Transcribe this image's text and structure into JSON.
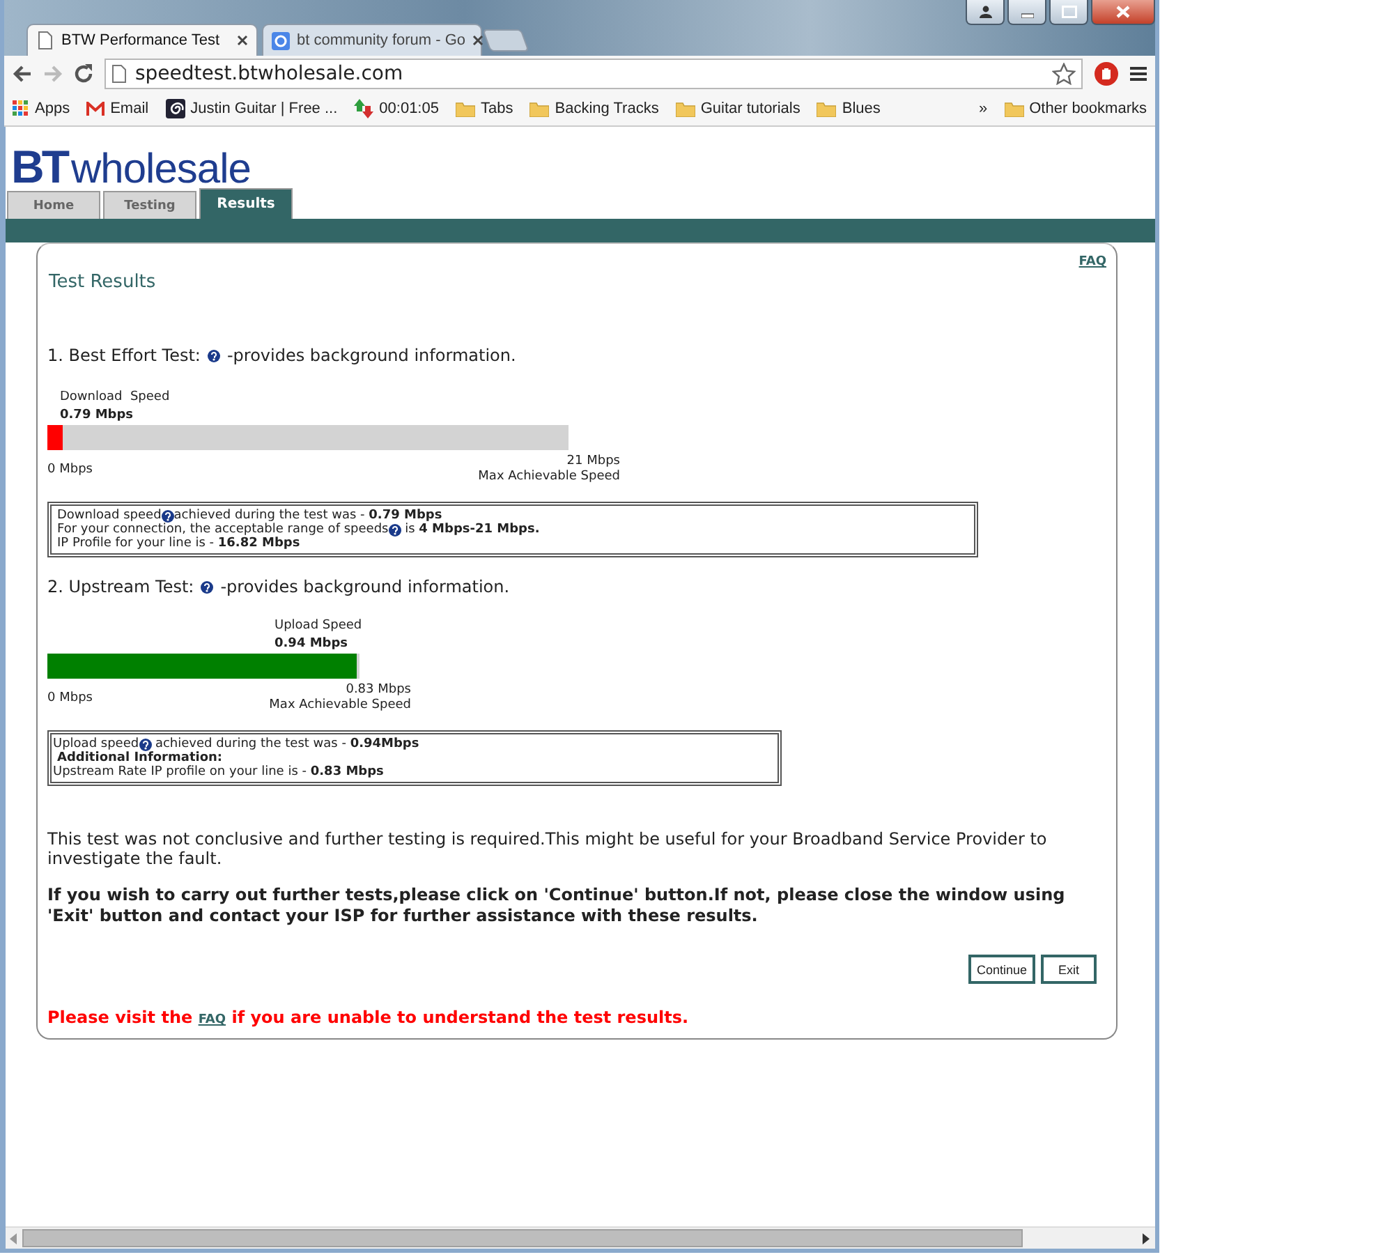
{
  "browser": {
    "tabs": [
      {
        "title": "BTW Performance Test",
        "selected": true
      },
      {
        "title": "bt community forum - Go",
        "selected": false
      }
    ],
    "address": "speedtest.btwholesale.com",
    "bookmarks": [
      {
        "label": "Apps",
        "kind": "apps"
      },
      {
        "label": "Email",
        "kind": "mail"
      },
      {
        "label": "Justin Guitar | Free ...",
        "kind": "site"
      },
      {
        "label": "00:01:05",
        "kind": "timer"
      },
      {
        "label": "Tabs",
        "kind": "folder"
      },
      {
        "label": "Backing Tracks",
        "kind": "folder"
      },
      {
        "label": "Guitar tutorials",
        "kind": "folder"
      },
      {
        "label": "Blues",
        "kind": "folder"
      }
    ],
    "overflow": "»",
    "other_bookmarks": "Other bookmarks"
  },
  "page": {
    "logo": {
      "brand": "BT",
      "name": "wholesale"
    },
    "nav": [
      {
        "label": "Home",
        "selected": false
      },
      {
        "label": "Testing",
        "selected": false
      },
      {
        "label": "Results",
        "selected": true
      }
    ],
    "faq_link": "FAQ",
    "title": "Test Results",
    "tests": [
      {
        "heading": {
          "text": "1. Best Effort Test:",
          "help": true,
          "rest": "-provides background information."
        },
        "speed_label": "Download  Speed",
        "speed_value": "0.79 Mbps",
        "level": 0.03,
        "color": "#ff0000",
        "min_label": "0 Mbps",
        "max_value": "21 Mbps",
        "max_caption": "Max Achievable Speed",
        "info": [
          {
            "text": "Download speed",
            "help": true,
            "rest": "achieved during the test was - **0.79 Mbps**",
            "bold": false
          },
          {
            "text": "For your connection, the acceptable range of speeds",
            "help": true,
            "rest": " is **4 Mbps-21 Mbps.**",
            "bold": false
          },
          {
            "text": "IP Profile for your line is - **16.82 Mbps**",
            "help": false,
            "bold": false
          }
        ]
      },
      {
        "heading": {
          "text": "2. Upstream Test:",
          "help": true,
          "rest": "-provides background information."
        },
        "speed_label": "Upload Speed",
        "speed_value": "0.94 Mbps",
        "level": 0.99,
        "color": "#008000",
        "min_label": "0 Mbps",
        "max_value": "0.83 Mbps",
        "max_caption": "Max Achievable Speed",
        "info": [
          {
            "text": "Upload speed",
            "help": true,
            "rest": " achieved during the test was - **0.94Mbps**",
            "bold": false
          },
          {
            "text": "Additional Information:",
            "help": false,
            "bold": true
          },
          {
            "text": "Upstream Rate IP profile on your line is - **0.83 Mbps**",
            "help": false,
            "bold": false
          }
        ]
      }
    ],
    "note": "This test was not conclusive and further testing is required.This might be useful for your Broadband Service Provider to investigate the fault.",
    "instruction": "If you wish to carry out further tests,please click on 'Continue' button.If not, please close the window using 'Exit' button and contact your ISP for further assistance with these results.",
    "buttons": [
      "Continue",
      "Exit"
    ],
    "faq_notice": {
      "before": "Please visit the ",
      "link": "FAQ",
      "after": " if you are unable to understand the test results."
    }
  }
}
